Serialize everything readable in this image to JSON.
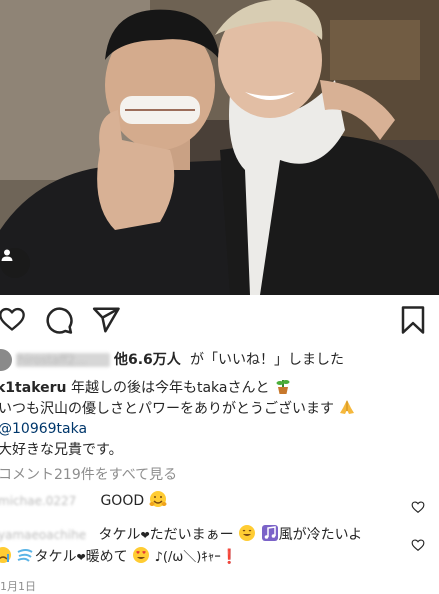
{
  "post": {
    "likes": {
      "liker_name": "hirostaff2...",
      "count_text": "他6.6万人",
      "rest_text": "が「いいね！」しました"
    },
    "caption": {
      "username": "k1takeru",
      "line1": "年越しの後は今年もtakaさんと",
      "line2": "いつも沢山の優しさとパワーをありがとうございます",
      "mention": "@10969taka",
      "line4": "大好きな兄貴です。"
    },
    "view_comments": "コメント219件をすべて見る",
    "comments": [
      {
        "user": "michae.0227",
        "text": "GOOD"
      },
      {
        "user": "yamaeoachihe",
        "text_a": "タケル",
        "text_b": "ただいまぁー",
        "text_c": "風が冷たいよ"
      },
      {
        "text_a": "タケル",
        "text_b": "暖めて",
        "text_c": "♪(/ω＼)ｷｬｰ"
      }
    ],
    "date": "1月1日"
  },
  "icons": [
    "user-tag-icon",
    "like-heart-icon",
    "comment-icon",
    "share-icon",
    "bookmark-icon",
    "comment-like-icon"
  ],
  "colors": {
    "text": "#262626",
    "muted": "#8e8e8e",
    "mention": "#00376b"
  }
}
